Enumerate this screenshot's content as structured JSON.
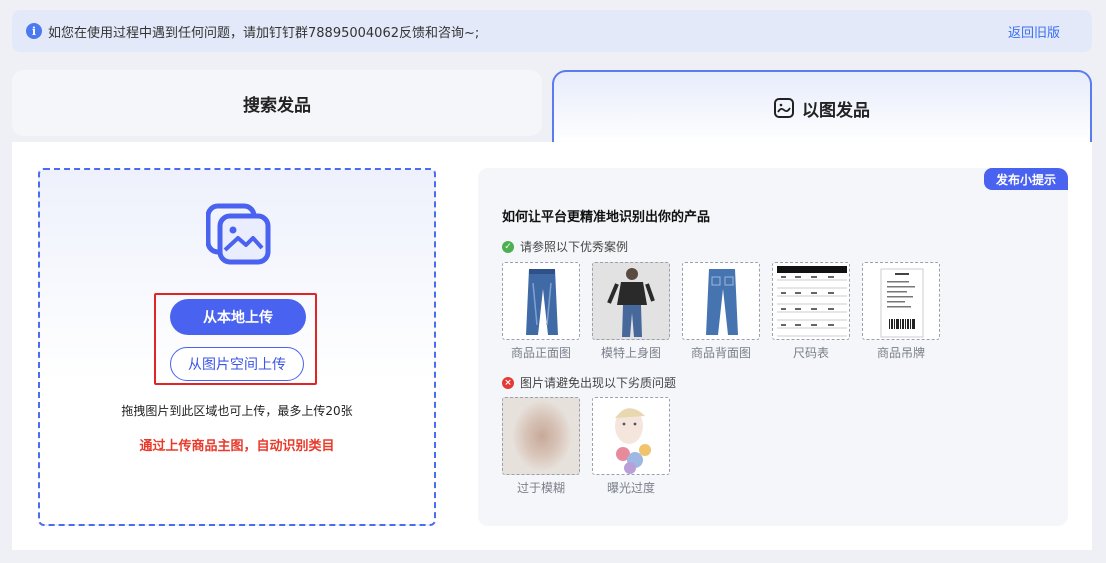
{
  "notice": {
    "text": "如您在使用过程中遇到任何问题，请加钉钉群78895004062反馈和咨询~;",
    "back_link": "返回旧版",
    "info_glyph": "i"
  },
  "tabs": [
    {
      "label": "搜索发品",
      "active": false
    },
    {
      "label": "以图发品",
      "active": true,
      "icon": "image-smile-icon"
    }
  ],
  "upload": {
    "local_button": "从本地上传",
    "space_button": "从图片空间上传",
    "drag_hint": "拖拽图片到此区域也可上传，最多上传20张",
    "auto_hint": "通过上传商品主图，自动识别类目"
  },
  "tips": {
    "badge": "发布小提示",
    "title": "如何让平台更精准地识别出你的产品",
    "good_section": "请参照以下优秀案例",
    "good_glyph": "✓",
    "good_examples": [
      "商品正面图",
      "模特上身图",
      "商品背面图",
      "尺码表",
      "商品吊牌"
    ],
    "bad_section": "图片请避免出现以下劣质问题",
    "bad_glyph": "×",
    "bad_examples": [
      "过于模糊",
      "曝光过度"
    ]
  },
  "colors": {
    "accent": "#4a62f0",
    "warning_red": "#e83a2a"
  }
}
